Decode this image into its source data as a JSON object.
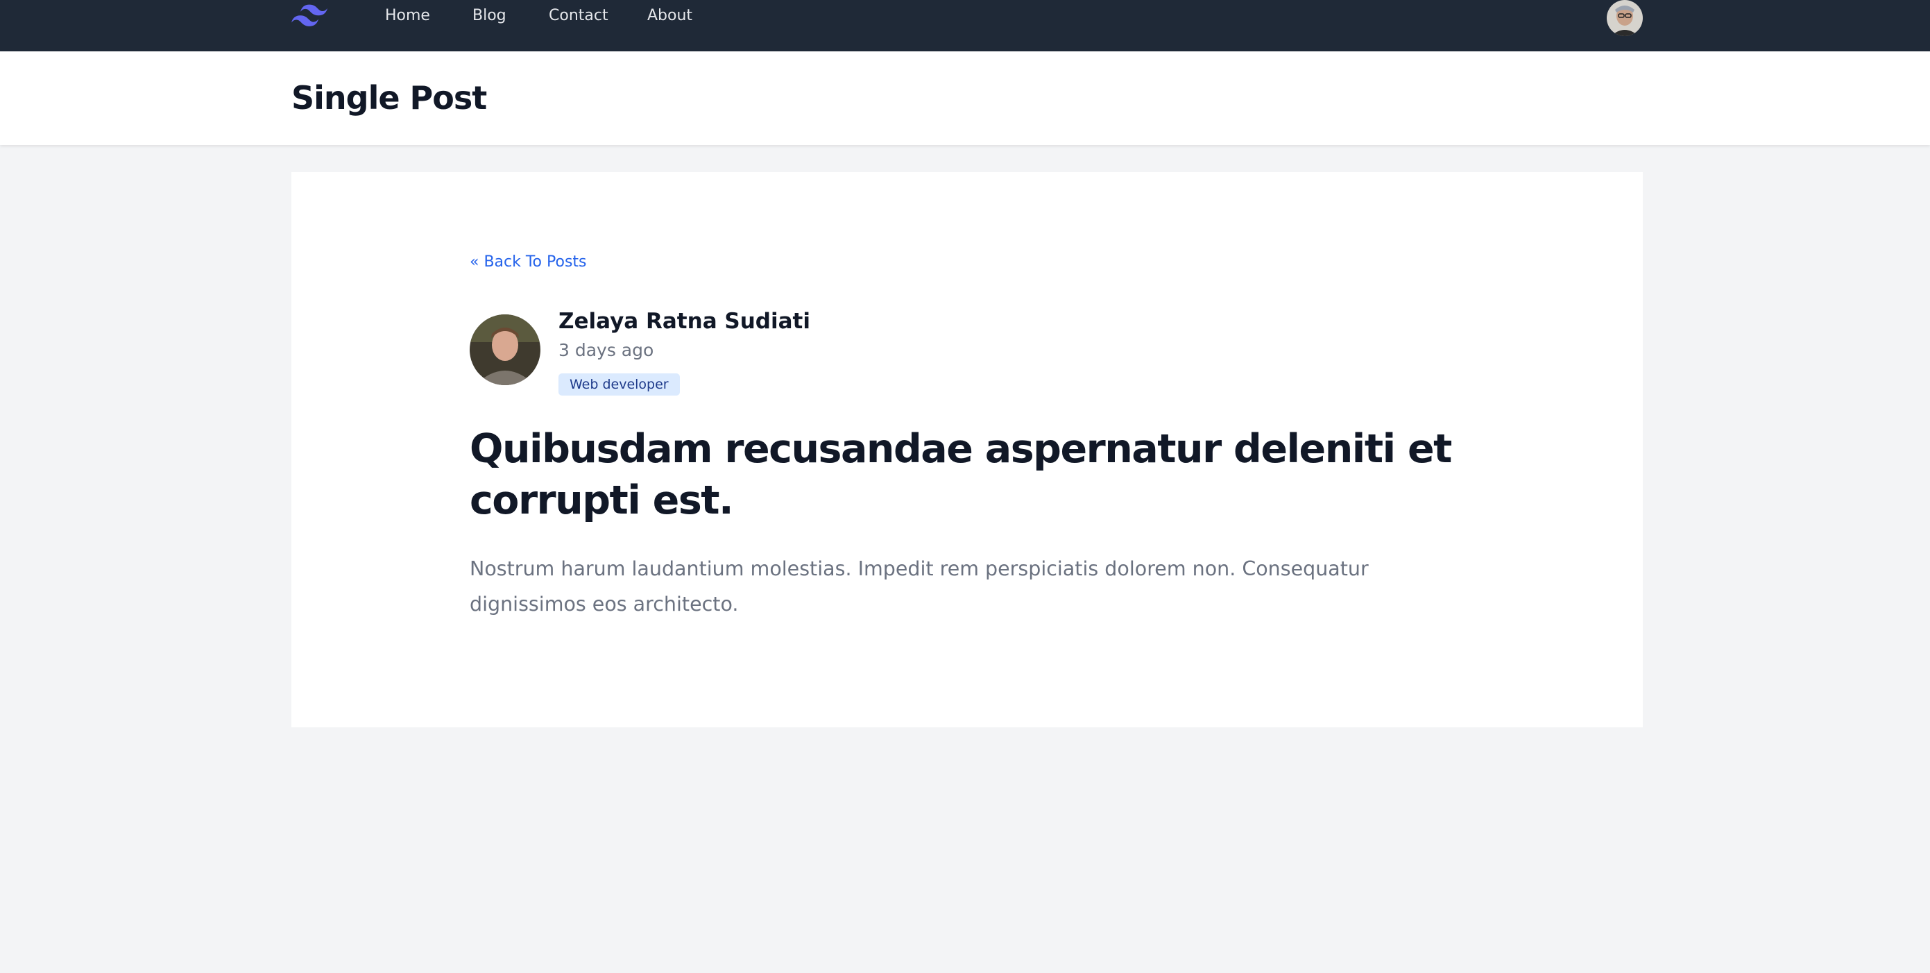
{
  "nav": {
    "logo_icon": "tailwind-wave-logo",
    "links": [
      {
        "label": "Home"
      },
      {
        "label": "Blog"
      },
      {
        "label": "Contact"
      },
      {
        "label": "About"
      }
    ],
    "user_avatar_icon": "user-avatar"
  },
  "header": {
    "title": "Single Post"
  },
  "post": {
    "back_label": "« Back To Posts",
    "author": {
      "name": "Zelaya Ratna Sudiati",
      "time": "3 days ago",
      "role": "Web developer"
    },
    "title": "Quibusdam recusandae aspernatur deleniti et corrupti est.",
    "body": "Nostrum harum laudantium molestias. Impedit rem perspiciatis dolorem non. Consequatur dignissimos eos architecto."
  },
  "colors": {
    "nav_bg": "#1f2937",
    "link_blue": "#2563eb",
    "badge_bg": "#dbeafe",
    "badge_text": "#1e3a8a",
    "page_bg": "#f3f4f6",
    "logo": "#6366f1"
  }
}
